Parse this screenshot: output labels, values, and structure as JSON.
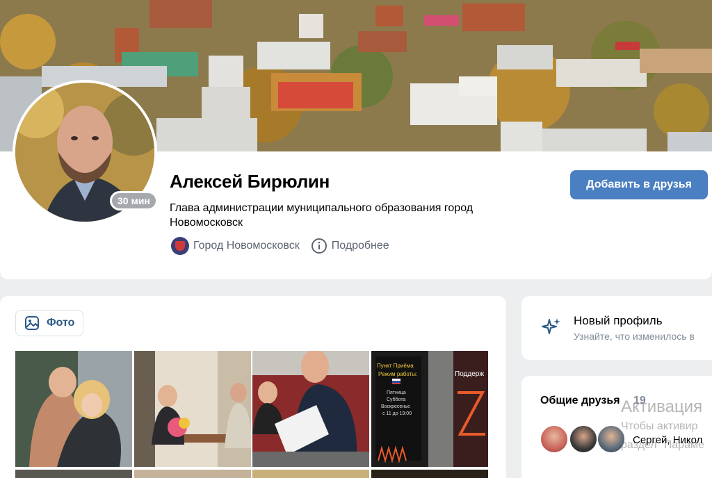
{
  "profile": {
    "name": "Алексей Бирюлин",
    "status": "Глава администрации муниципального образования город Новомосковск",
    "online_badge": "30 мин",
    "city_link": "Город Новомосковск",
    "details_link": "Подробнее",
    "add_friend_label": "Добавить в друзья"
  },
  "photos": {
    "tab_label": "Фото",
    "tile4_texts": [
      "Пункт Приёма",
      "Режим работы:",
      "Пятница",
      "Суббота",
      "Воскресенье",
      "с 11 до 19:00"
    ],
    "tile5_text": "Поддерж"
  },
  "new_profile": {
    "title": "Новый профиль",
    "subtitle": "Узнайте, что изменилось в"
  },
  "friends": {
    "title": "Общие друзья",
    "count": "19",
    "visible_name": "Сергей, Никол"
  },
  "watermark": {
    "line1": "Активация",
    "line2": "Чтобы активир",
    "line3": "раздел \"Параме"
  },
  "colors": {
    "accent": "#4a7fc1",
    "link": "#2a5885",
    "secondary_text": "#818c99",
    "background": "#edeef0"
  },
  "icons": {
    "photo_tab": "image-icon",
    "details": "info-icon",
    "new_profile": "sparkle-icon",
    "city": "city-coat-of-arms-icon"
  }
}
